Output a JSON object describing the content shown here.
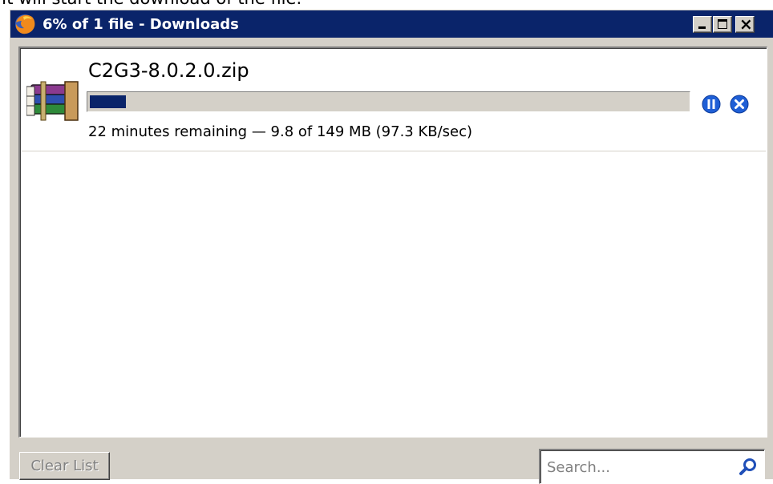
{
  "caption_above": "It will start the download of the file.",
  "window": {
    "title": "6% of 1 file - Downloads",
    "icon": "firefox-icon",
    "controls": {
      "minimize": "minimize-icon",
      "maximize": "maximize-icon",
      "close": "close-icon"
    },
    "accent_color": "#0a246a",
    "face_color": "#d4d0c8"
  },
  "downloads": [
    {
      "file_name": "C2G3-8.0.2.0.zip",
      "icon": "winrar-archive-icon",
      "progress_fraction": 0.06,
      "status": "22 minutes remaining — 9.8 of 149 MB (97.3 KB/sec)",
      "actions": [
        "pause-icon",
        "cancel-icon"
      ]
    }
  ],
  "footer": {
    "clear_list_label": "Clear List",
    "clear_list_enabled": false,
    "search_placeholder": "Search...",
    "search_icon": "magnifier-icon"
  }
}
